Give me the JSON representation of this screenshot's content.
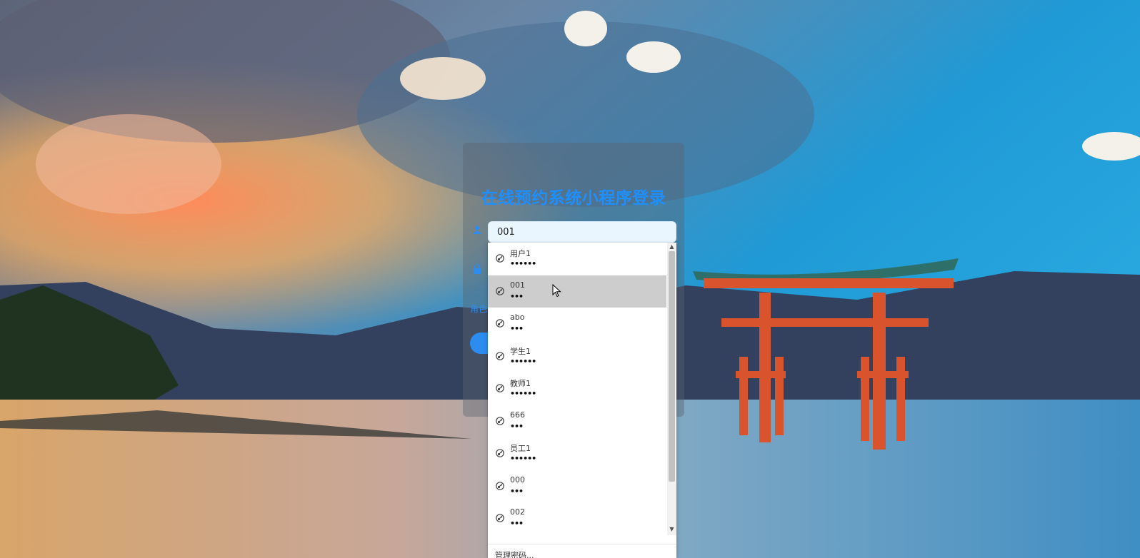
{
  "login": {
    "title": "在线预约系统小程序登录",
    "role_label": "角色",
    "username_value": "001",
    "accent_color": "#2d8cf0"
  },
  "autocomplete": {
    "items": [
      {
        "name": "用户1",
        "mask": "••••••",
        "icon": "key-icon"
      },
      {
        "name": "001",
        "mask": "•••",
        "icon": "key-icon",
        "active": true
      },
      {
        "name": "abo",
        "mask": "•••",
        "icon": "key-icon"
      },
      {
        "name": "学生1",
        "mask": "••••••",
        "icon": "key-icon"
      },
      {
        "name": "教师1",
        "mask": "••••••",
        "icon": "key-icon"
      },
      {
        "name": "666",
        "mask": "•••",
        "icon": "key-icon"
      },
      {
        "name": "员工1",
        "mask": "••••••",
        "icon": "key-icon"
      },
      {
        "name": "000",
        "mask": "•••",
        "icon": "key-icon"
      },
      {
        "name": "002",
        "mask": "•••",
        "icon": "key-icon"
      }
    ],
    "manage_label": "管理密码..."
  }
}
